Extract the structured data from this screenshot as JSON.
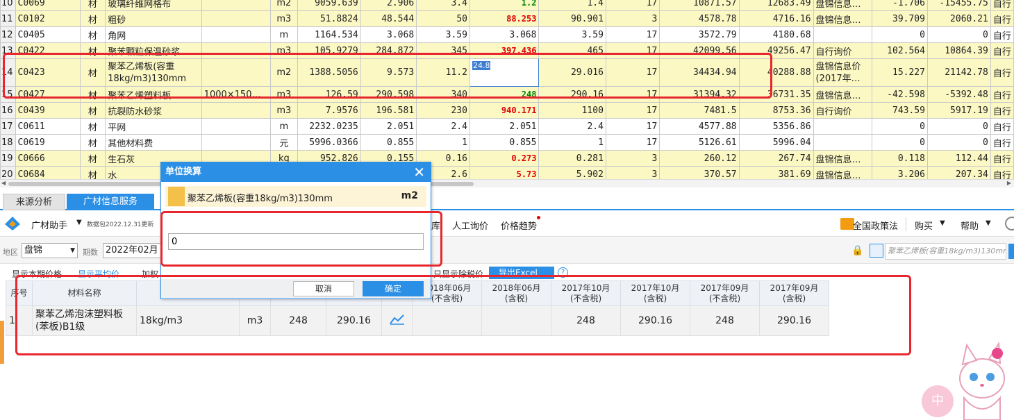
{
  "grid_rows": [
    {
      "rn": "10",
      "code": "C0069",
      "type": "材",
      "name": "玻璃纤维网格布",
      "spec": "",
      "unit": "m2",
      "qty": "9059.639",
      "p1": "2.906",
      "p2": "3.4",
      "p3": "1.2",
      "p4": "1.4",
      "tax": "17",
      "amt1": "10871.57",
      "amt2": "12683.49",
      "src": "盘锦信息…",
      "diff": "-1.706",
      "diffamt": "-15455.75",
      "last": "自行",
      "style": "yellow",
      "p3color": "green"
    },
    {
      "rn": "11",
      "code": "C0102",
      "type": "材",
      "name": "粗砂",
      "spec": "",
      "unit": "m3",
      "qty": "51.8824",
      "p1": "48.544",
      "p2": "50",
      "p3": "88.253",
      "p4": "90.901",
      "tax": "3",
      "amt1": "4578.78",
      "amt2": "4716.16",
      "src": "盘锦信息…",
      "diff": "39.709",
      "diffamt": "2060.21",
      "last": "自行",
      "style": "yellow",
      "p3color": "red"
    },
    {
      "rn": "12",
      "code": "C0405",
      "type": "材",
      "name": "角网",
      "spec": "",
      "unit": "m",
      "qty": "1164.534",
      "p1": "3.068",
      "p2": "3.59",
      "p3": "3.068",
      "p4": "3.59",
      "tax": "17",
      "amt1": "3572.79",
      "amt2": "4180.68",
      "src": "",
      "diff": "0",
      "diffamt": "0",
      "last": "自行",
      "style": "white",
      "p3color": ""
    },
    {
      "rn": "13",
      "code": "C0422",
      "type": "材",
      "name": "聚苯颗粒保温砂浆",
      "spec": "",
      "unit": "m3",
      "qty": "105.9279",
      "p1": "284.872",
      "p2": "345",
      "p3": "397.436",
      "p4": "465",
      "tax": "17",
      "amt1": "42099.56",
      "amt2": "49256.47",
      "src": "自行询价",
      "diff": "102.564",
      "diffamt": "10864.39",
      "last": "自行",
      "style": "yellow",
      "p3color": "red"
    },
    {
      "rn": "14",
      "code": "C0423",
      "type": "材",
      "name": "聚苯乙烯板(容重18kg/m3)130mm",
      "spec": "",
      "unit": "m2",
      "qty": "1388.5056",
      "p1": "9.573",
      "p2": "11.2",
      "p3": "24.8",
      "p4": "29.016",
      "tax": "17",
      "amt1": "34434.94",
      "amt2": "40288.88",
      "src": "盘锦信息价(2017年…",
      "diff": "15.227",
      "diffamt": "21142.78",
      "last": "自行",
      "style": "yellow",
      "p3color": "sel",
      "tall": true
    },
    {
      "rn": "15",
      "code": "C0427",
      "type": "材",
      "name": "聚苯乙烯塑料板",
      "spec": "1000×150…",
      "unit": "m3",
      "qty": "126.59",
      "p1": "290.598",
      "p2": "340",
      "p3": "248",
      "p4": "290.16",
      "tax": "17",
      "amt1": "31394.32",
      "amt2": "36731.35",
      "src": "盘锦信息…",
      "diff": "-42.598",
      "diffamt": "-5392.48",
      "last": "自行",
      "style": "yellow",
      "p3color": "green"
    },
    {
      "rn": "16",
      "code": "C0439",
      "type": "材",
      "name": "抗裂防水砂浆",
      "spec": "",
      "unit": "m3",
      "qty": "7.9576",
      "p1": "196.581",
      "p2": "230",
      "p3": "940.171",
      "p4": "1100",
      "tax": "17",
      "amt1": "7481.5",
      "amt2": "8753.36",
      "src": "自行询价",
      "diff": "743.59",
      "diffamt": "5917.19",
      "last": "自行",
      "style": "yellow",
      "p3color": "red"
    },
    {
      "rn": "17",
      "code": "C0611",
      "type": "材",
      "name": "平网",
      "spec": "",
      "unit": "m",
      "qty": "2232.0235",
      "p1": "2.051",
      "p2": "2.4",
      "p3": "2.051",
      "p4": "2.4",
      "tax": "17",
      "amt1": "4577.88",
      "amt2": "5356.86",
      "src": "",
      "diff": "0",
      "diffamt": "0",
      "last": "自行",
      "style": "white",
      "p3color": ""
    },
    {
      "rn": "18",
      "code": "C0619",
      "type": "材",
      "name": "其他材料费",
      "spec": "",
      "unit": "元",
      "qty": "5996.0366",
      "p1": "0.855",
      "p2": "1",
      "p3": "0.855",
      "p4": "1",
      "tax": "17",
      "amt1": "5126.61",
      "amt2": "5996.04",
      "src": "",
      "diff": "0",
      "diffamt": "0",
      "last": "自行",
      "style": "white",
      "p3color": ""
    },
    {
      "rn": "19",
      "code": "C0666",
      "type": "材",
      "name": "生石灰",
      "spec": "",
      "unit": "kg",
      "qty": "952.826",
      "p1": "0.155",
      "p2": "0.16",
      "p3": "0.273",
      "p4": "0.281",
      "tax": "3",
      "amt1": "260.12",
      "amt2": "267.74",
      "src": "盘锦信息…",
      "diff": "0.118",
      "diffamt": "112.44",
      "last": "自行",
      "style": "yellow",
      "p3color": "red"
    },
    {
      "rn": "20",
      "code": "C0684",
      "type": "材",
      "name": "水",
      "spec": "",
      "unit": "m3",
      "qty": "142.3",
      "p1": "2.6",
      "p2": "2.6",
      "p3": "5.73",
      "p4": "5.902",
      "tax": "3",
      "amt1": "370.57",
      "amt2": "381.69",
      "src": "盘锦信息…",
      "diff": "3.206",
      "diffamt": "207.34",
      "last": "自行",
      "style": "yellow",
      "p3color": "red"
    }
  ],
  "tabs": {
    "source_analysis": "来源分析",
    "material_info": "广材信息服务"
  },
  "toolbar": {
    "assistant": "广材助手",
    "db_info": "数据包2022.12.31更新",
    "item_lib": "库",
    "manual_inquiry": "人工询价",
    "price_trend": "价格趋势",
    "national_policy": "全国政策法",
    "buy": "购买",
    "help": "帮助"
  },
  "filter": {
    "region_label": "地区",
    "region_value": "盘锦",
    "period_label": "期数",
    "period_value": "2022年02月",
    "search_placeholder": "聚苯乙烯板(容重18kg/m3)130mm"
  },
  "subtabs": {
    "show_period": "显示本期价格",
    "show_avg": "显示平均价",
    "weighted": "加权",
    "show_tax": "只显示除税价",
    "export": "导出Excel"
  },
  "price_table": {
    "headers": [
      "序号",
      "材料名称",
      "",
      "",
      "",
      "",
      "",
      "2018年06月\n(不含税)",
      "2018年06月\n(含税)",
      "2017年10月\n(不含税)",
      "2017年10月\n(含税)",
      "2017年09月\n(不含税)",
      "2017年09月\n(含税)"
    ],
    "rows": [
      {
        "no": "1",
        "name": "聚苯乙烯泡沫塑料板(苯板)B1级",
        "spec": "18kg/m3",
        "unit": "m3",
        "p_ex": "248",
        "p_in": "290.16",
        "c1": "",
        "c2": "",
        "c3": "248",
        "c4": "290.16",
        "c5": "248",
        "c6": "290.16"
      }
    ]
  },
  "dialog": {
    "title": "单位换算",
    "material": "聚苯乙烯板(容重18kg/m3)130mm",
    "unit": "m2",
    "input_value": "0",
    "cancel": "取消",
    "ok": "确定"
  },
  "decoration": {
    "badge_text": "中"
  },
  "colors": {
    "accent": "#2b8fe6",
    "annotation": "#e8262d",
    "row_yellow": "#fbf8c4",
    "price_red": "#e00000",
    "price_green": "#008800"
  }
}
